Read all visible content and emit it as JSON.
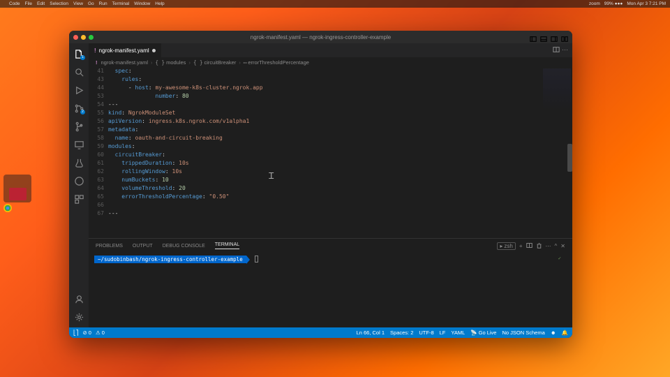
{
  "menubar": {
    "items": [
      "Code",
      "File",
      "Edit",
      "Selection",
      "View",
      "Go",
      "Run",
      "Terminal",
      "Window",
      "Help"
    ],
    "right_items": [
      "zoom",
      "99% ●●●",
      "Mon Apr 3  7:21 PM"
    ]
  },
  "window": {
    "title": "ngrok-manifest.yaml — ngrok-ingress-controller-example"
  },
  "tab": {
    "filename": "ngrok-manifest.yaml",
    "modified": true
  },
  "breadcrumbs": [
    "ngrok-manifest.yaml",
    "modules",
    "circuitBreaker",
    "errorThresholdPercentage"
  ],
  "activity_badges": {
    "explorer": "1",
    "scm": "2"
  },
  "code": {
    "lines": [
      {
        "n": 41,
        "segs": [
          {
            "t": "  ",
            "c": "guide"
          },
          {
            "t": "spec",
            "c": "key"
          },
          {
            "t": ":",
            "c": "punct"
          }
        ]
      },
      {
        "n": 43,
        "segs": [
          {
            "t": "    ",
            "c": "guide"
          },
          {
            "t": "rules",
            "c": "key"
          },
          {
            "t": ":",
            "c": "punct"
          }
        ]
      },
      {
        "n": 44,
        "segs": [
          {
            "t": "      - ",
            "c": "punct"
          },
          {
            "t": "host",
            "c": "key"
          },
          {
            "t": ": ",
            "c": "punct"
          },
          {
            "t": "my-awesome-k8s-cluster.ngrok.app",
            "c": "str"
          }
        ]
      },
      {
        "n": 53,
        "segs": [
          {
            "t": "              ",
            "c": "guide"
          },
          {
            "t": "number",
            "c": "key"
          },
          {
            "t": ": ",
            "c": "punct"
          },
          {
            "t": "80",
            "c": "num"
          }
        ]
      },
      {
        "n": 54,
        "segs": [
          {
            "t": "---",
            "c": "punct"
          }
        ]
      },
      {
        "n": 55,
        "segs": [
          {
            "t": "kind",
            "c": "key"
          },
          {
            "t": ": ",
            "c": "punct"
          },
          {
            "t": "NgrokModuleSet",
            "c": "str"
          }
        ]
      },
      {
        "n": 56,
        "segs": [
          {
            "t": "apiVersion",
            "c": "key"
          },
          {
            "t": ": ",
            "c": "punct"
          },
          {
            "t": "ingress.k8s.ngrok.com/v1alpha1",
            "c": "str"
          }
        ]
      },
      {
        "n": 57,
        "segs": [
          {
            "t": "metadata",
            "c": "key"
          },
          {
            "t": ":",
            "c": "punct"
          }
        ]
      },
      {
        "n": 58,
        "segs": [
          {
            "t": "  ",
            "c": "guide"
          },
          {
            "t": "name",
            "c": "key"
          },
          {
            "t": ": ",
            "c": "punct"
          },
          {
            "t": "oauth-and-circuit-breaking",
            "c": "str"
          }
        ]
      },
      {
        "n": 59,
        "segs": [
          {
            "t": "modules",
            "c": "key"
          },
          {
            "t": ":",
            "c": "punct"
          }
        ]
      },
      {
        "n": 60,
        "segs": [
          {
            "t": "  ",
            "c": "guide"
          },
          {
            "t": "circuitBreaker",
            "c": "key"
          },
          {
            "t": ":",
            "c": "punct"
          }
        ]
      },
      {
        "n": 61,
        "segs": [
          {
            "t": "    ",
            "c": "guide"
          },
          {
            "t": "trippedDuration",
            "c": "key"
          },
          {
            "t": ": ",
            "c": "punct"
          },
          {
            "t": "10s",
            "c": "str"
          }
        ]
      },
      {
        "n": 62,
        "segs": [
          {
            "t": "    ",
            "c": "guide"
          },
          {
            "t": "rollingWindow",
            "c": "key"
          },
          {
            "t": ": ",
            "c": "punct"
          },
          {
            "t": "10s",
            "c": "str"
          }
        ]
      },
      {
        "n": 63,
        "segs": [
          {
            "t": "    ",
            "c": "guide"
          },
          {
            "t": "numBuckets",
            "c": "key"
          },
          {
            "t": ": ",
            "c": "punct"
          },
          {
            "t": "10",
            "c": "num"
          }
        ]
      },
      {
        "n": 64,
        "segs": [
          {
            "t": "    ",
            "c": "guide"
          },
          {
            "t": "volumeThreshold",
            "c": "key"
          },
          {
            "t": ": ",
            "c": "punct"
          },
          {
            "t": "20",
            "c": "num"
          }
        ]
      },
      {
        "n": 65,
        "segs": [
          {
            "t": "    ",
            "c": "guide"
          },
          {
            "t": "errorThresholdPercentage",
            "c": "key"
          },
          {
            "t": ": ",
            "c": "punct"
          },
          {
            "t": "\"0.50\"",
            "c": "str"
          }
        ]
      },
      {
        "n": 66,
        "segs": [
          {
            "t": " ",
            "c": "punct"
          }
        ]
      },
      {
        "n": 67,
        "segs": [
          {
            "t": "---",
            "c": "punct"
          }
        ]
      }
    ]
  },
  "panel": {
    "tabs": [
      "PROBLEMS",
      "OUTPUT",
      "DEBUG CONSOLE",
      "TERMINAL"
    ],
    "active_tab": "TERMINAL",
    "shell": "zsh",
    "prompt": "~/sudobinbash/ngrok-ingress-controller-example"
  },
  "status": {
    "left": {
      "errors": "0",
      "warnings": "0"
    },
    "right": {
      "cursor": "Ln 66, Col 1",
      "spaces": "Spaces: 2",
      "encoding": "UTF-8",
      "eol": "LF",
      "lang": "YAML",
      "golive": "Go Live",
      "schema": "No JSON Schema"
    }
  }
}
